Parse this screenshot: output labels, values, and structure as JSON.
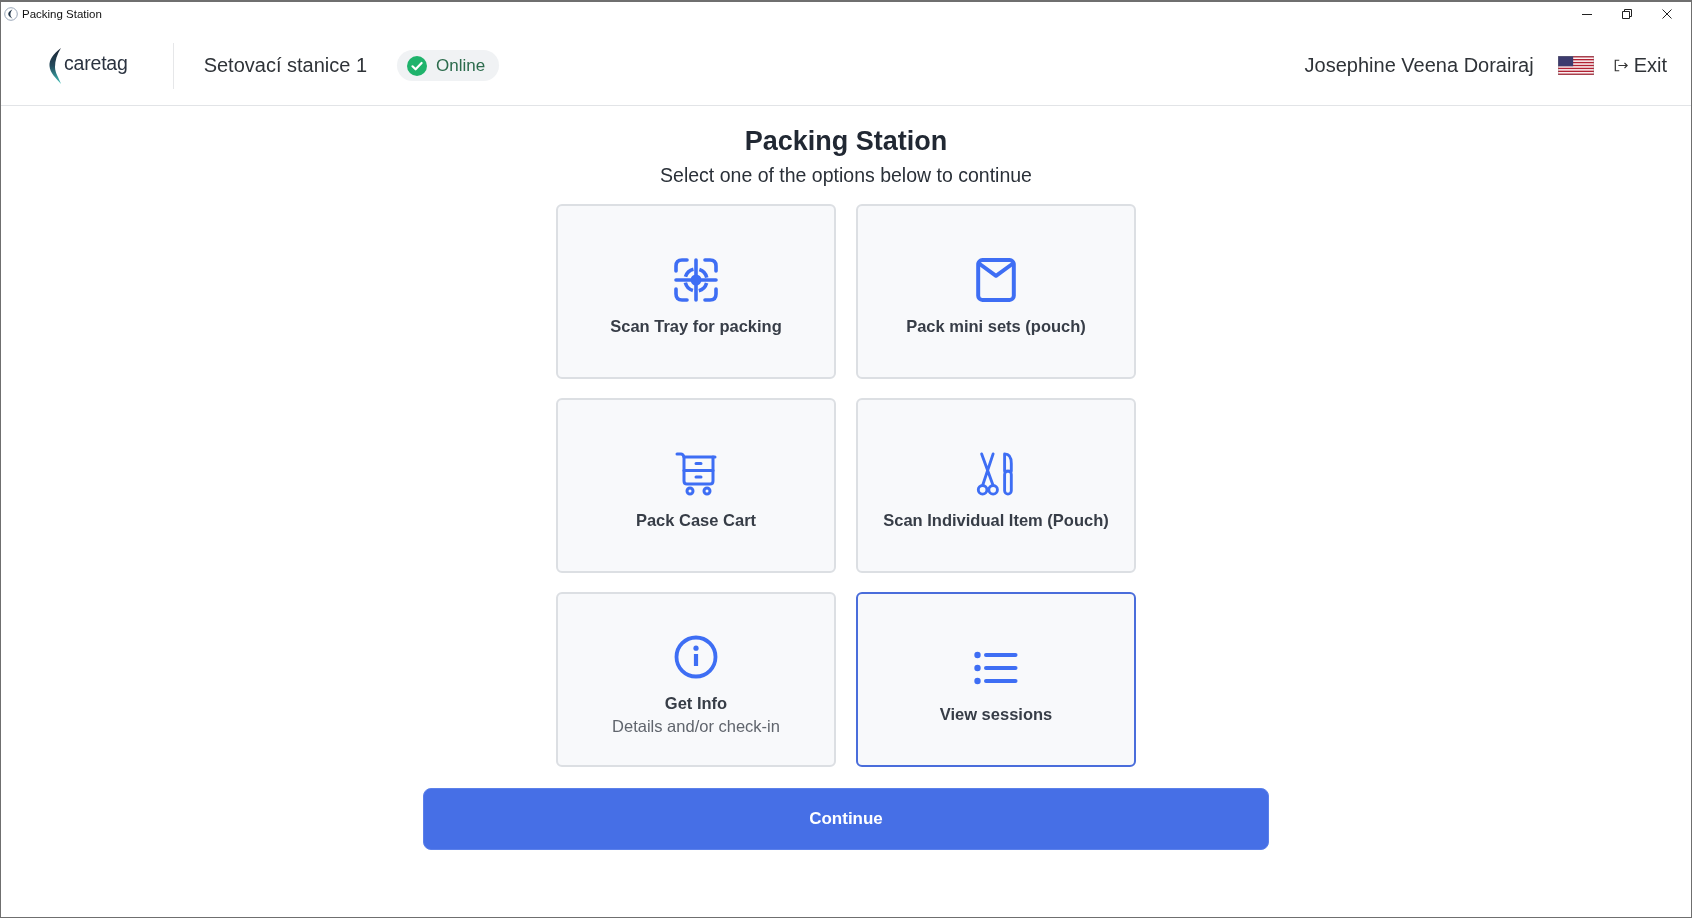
{
  "window": {
    "title": "Packing Station"
  },
  "header": {
    "logo": "caretag",
    "station": "Setovací stanice 1",
    "status": {
      "label": "Online",
      "online": true
    },
    "user": "Josephine Veena Dorairaj",
    "exit": "Exit"
  },
  "page": {
    "title": "Packing Station",
    "subtitle": "Select one of the options below to continue"
  },
  "options": [
    {
      "kind": "scan",
      "label": "Scan Tray for packing",
      "selected": false
    },
    {
      "kind": "envelope",
      "label": "Pack mini sets (pouch)",
      "selected": false
    },
    {
      "kind": "cart",
      "label": "Pack Case Cart",
      "selected": false
    },
    {
      "kind": "instruments",
      "label": "Scan Individual Item (Pouch)",
      "selected": false
    },
    {
      "kind": "info",
      "label": "Get Info",
      "description": "Details and/or check-in",
      "selected": false
    },
    {
      "kind": "list",
      "label": "View sessions",
      "selected": true
    }
  ],
  "continue_button": "Continue"
}
